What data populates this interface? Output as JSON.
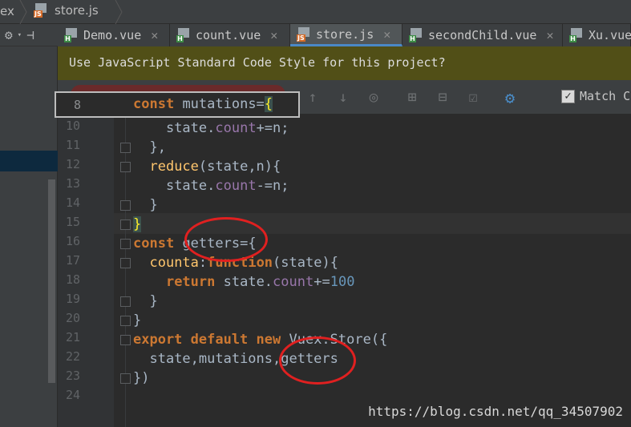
{
  "breadcrumb": {
    "prev": "ex",
    "file": "store.js"
  },
  "tabs": [
    {
      "label": "Demo.vue",
      "type": "vue",
      "active": false
    },
    {
      "label": "count.vue",
      "type": "vue",
      "active": false
    },
    {
      "label": "store.js",
      "type": "js",
      "active": true
    },
    {
      "label": "secondChild.vue",
      "type": "vue",
      "active": false
    },
    {
      "label": "Xu.vue",
      "type": "vue",
      "active": false
    }
  ],
  "banner": {
    "text": "Use JavaScript Standard Code Style for this project?"
  },
  "find_toolbar": {
    "match_label": "Match C",
    "match_checked": true
  },
  "editor": {
    "peek_line": {
      "number": "8"
    },
    "line_numbers": [
      "10",
      "11",
      "12",
      "13",
      "14",
      "15",
      "16",
      "17",
      "18",
      "19",
      "20",
      "21",
      "22",
      "23",
      "24"
    ]
  },
  "watermark": "https://blog.csdn.net/qq_34507902",
  "colors": {
    "background": "#2b2b2b",
    "banner": "#514f17",
    "annotation": "#e02020",
    "active_tab_underline": "#4a88c7"
  }
}
